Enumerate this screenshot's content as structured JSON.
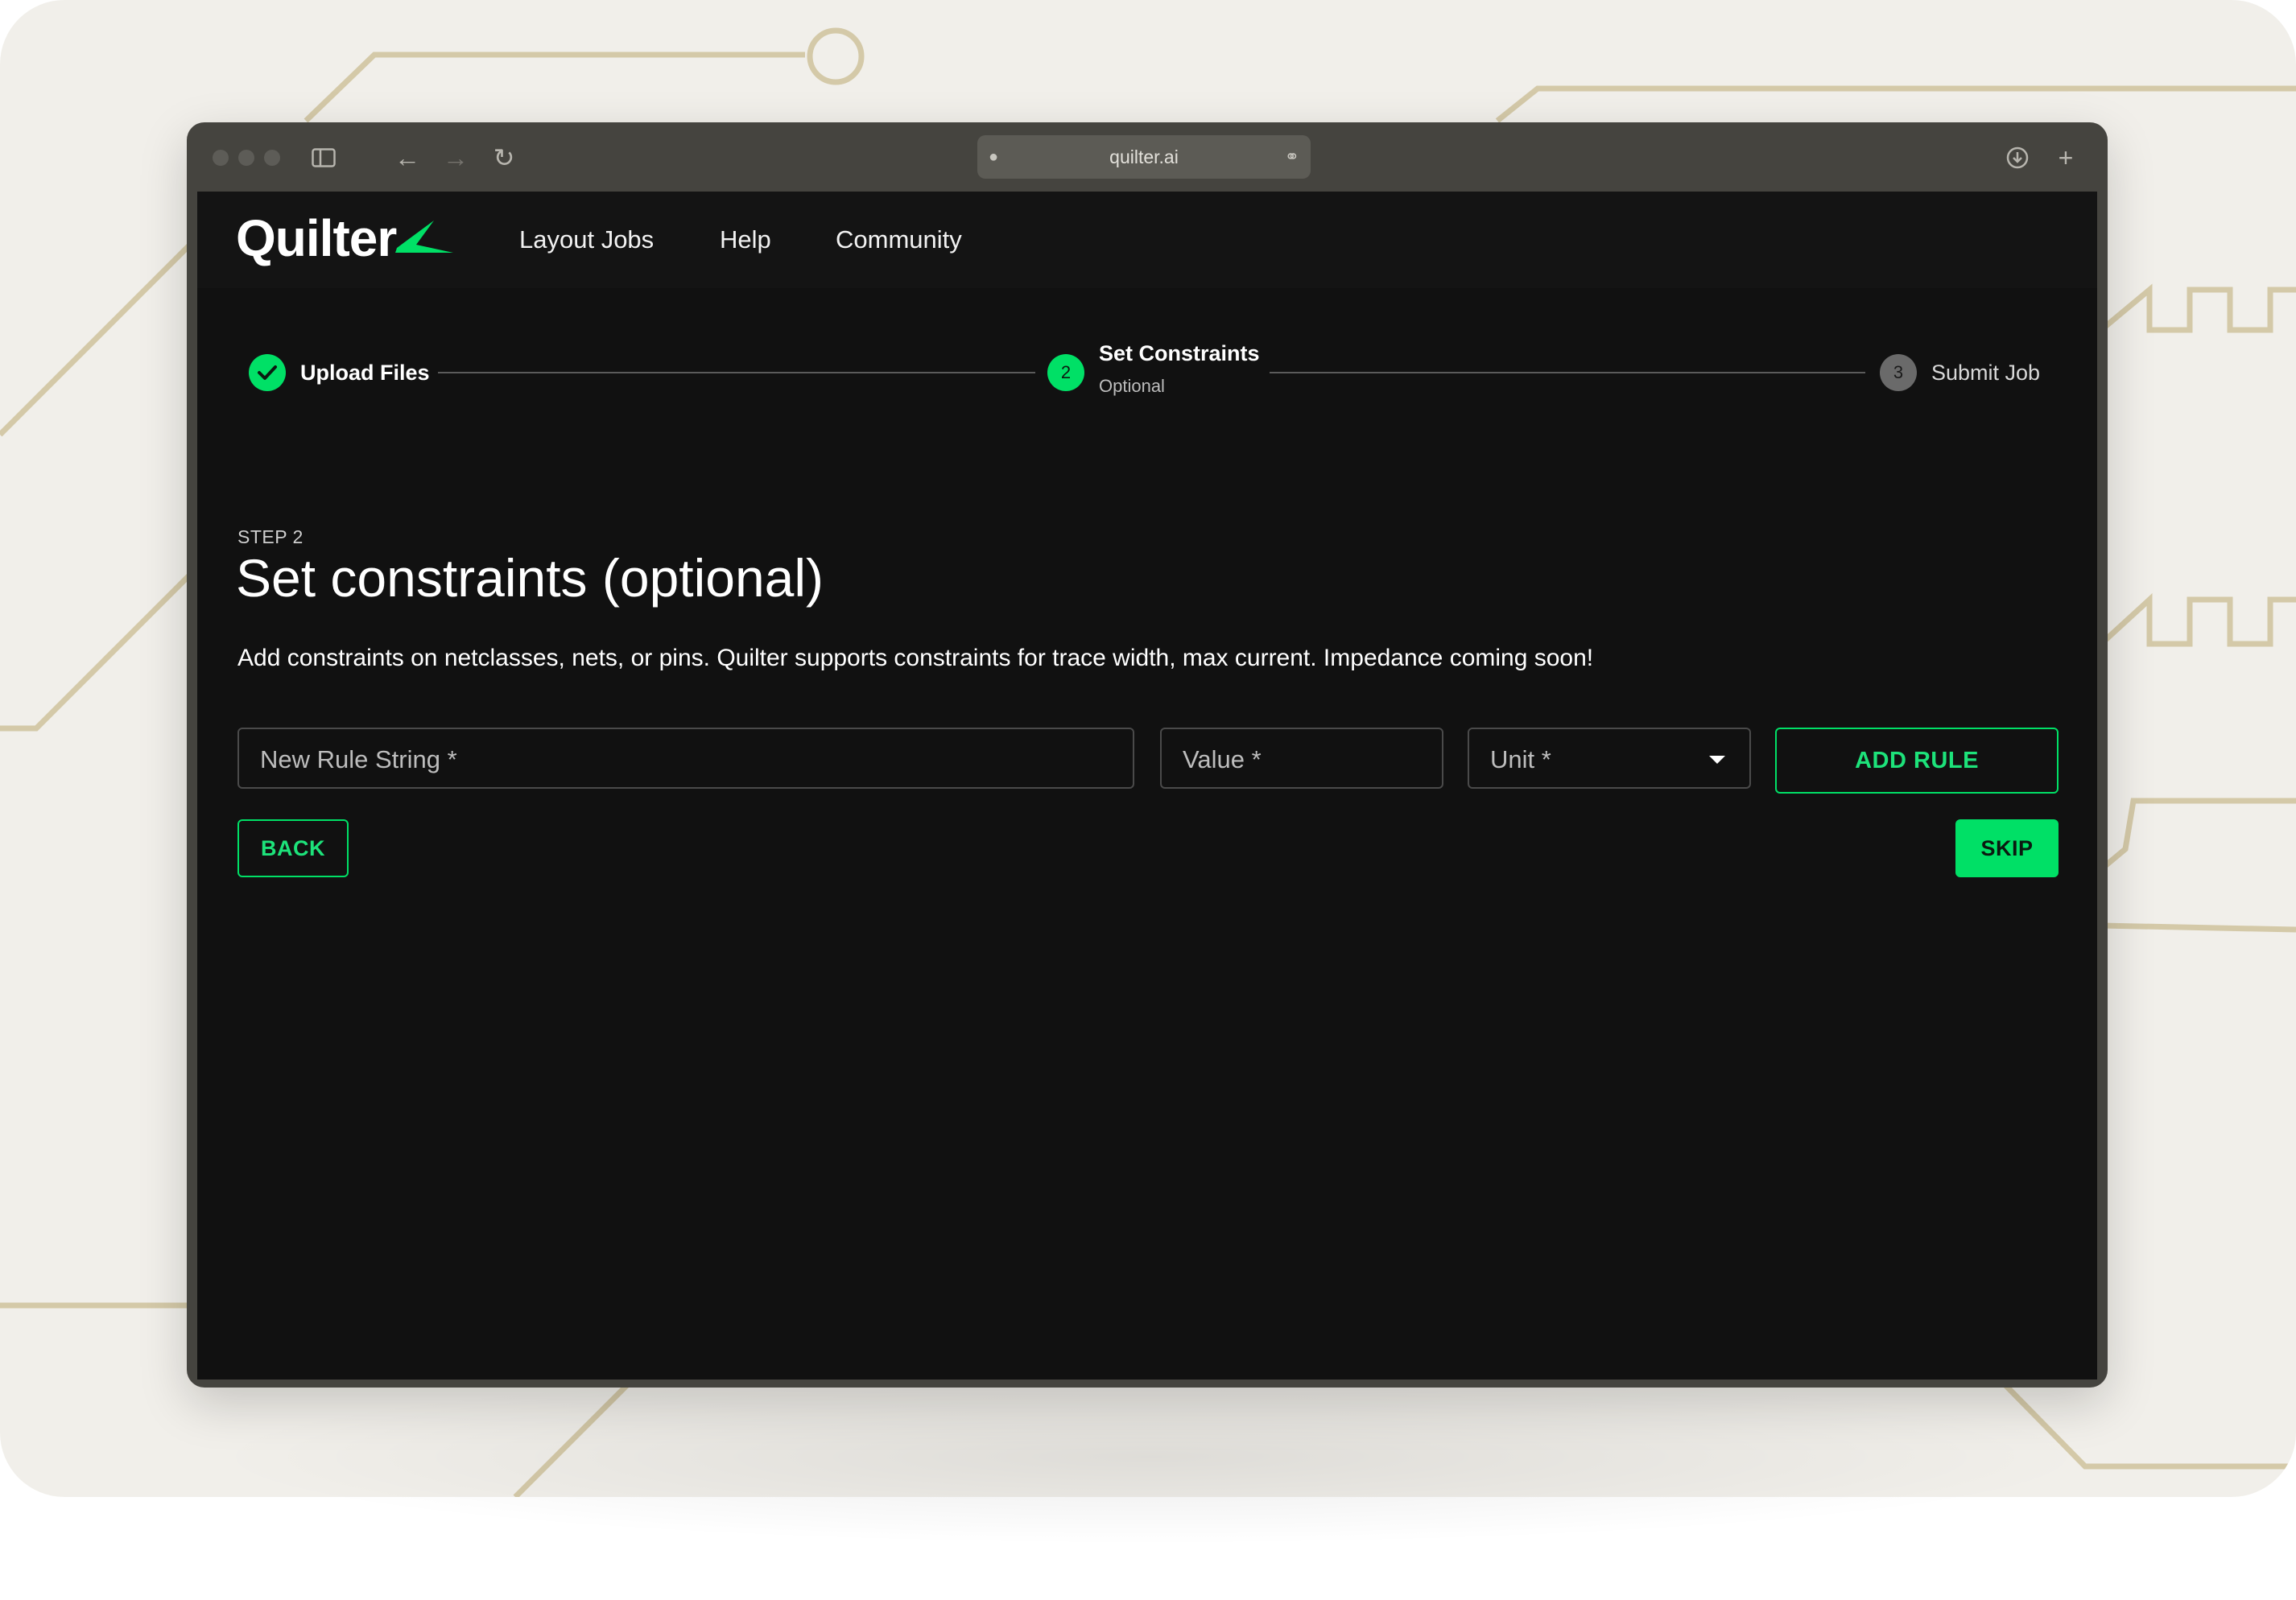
{
  "browser": {
    "url": "quilter.ai",
    "icons": {
      "sidebar": "sidebar-icon",
      "back": "back-arrow-icon",
      "forward": "forward-arrow-icon",
      "reload": "reload-icon",
      "lock": "lock-icon",
      "link": "link-icon",
      "download": "download-icon",
      "new_tab": "plus-icon"
    }
  },
  "app": {
    "brand": "Quilter",
    "accent_color": "#00e066",
    "nav": [
      {
        "label": "Layout Jobs"
      },
      {
        "label": "Help"
      },
      {
        "label": "Community"
      }
    ]
  },
  "stepper": {
    "steps": [
      {
        "label": "Upload Files",
        "status": "completed",
        "icon": "check-icon"
      },
      {
        "number": "2",
        "label": "Set Constraints",
        "sublabel": "Optional",
        "status": "active"
      },
      {
        "number": "3",
        "label": "Submit Job",
        "status": "pending"
      }
    ]
  },
  "main": {
    "kicker": "STEP 2",
    "title": "Set constraints (optional)",
    "description": "Add constraints on netclasses, nets, or pins. Quilter supports constraints for trace width, max current. Impedance coming soon!",
    "form": {
      "rule_placeholder": "New Rule String *",
      "value_placeholder": "Value *",
      "unit_placeholder": "Unit *",
      "add_rule_label": "ADD RULE"
    },
    "back_label": "BACK",
    "skip_label": "SKIP"
  }
}
